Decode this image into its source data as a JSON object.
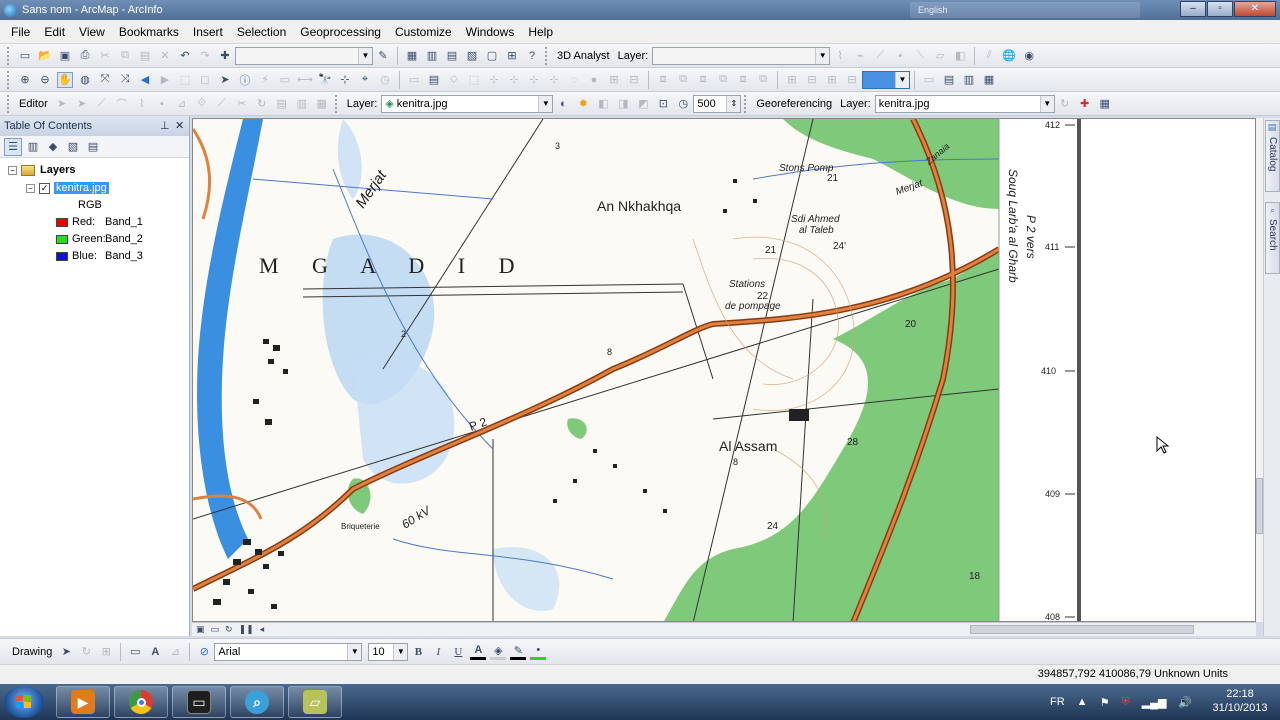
{
  "window": {
    "title": "Sans nom - ArcMap - ArcInfo",
    "language_indicator": "English"
  },
  "menu": [
    "File",
    "Edit",
    "View",
    "Bookmarks",
    "Insert",
    "Selection",
    "Geoprocessing",
    "Customize",
    "Windows",
    "Help"
  ],
  "toolbar1": {
    "analyst_label": "3D Analyst",
    "layer_label": "Layer:",
    "layer_value": ""
  },
  "toolbar3": {
    "editor_label": "Editor",
    "layer_label": "Layer:",
    "layer_value": "kenitra.jpg",
    "scale_value": "500",
    "georef_label": "Georeferencing",
    "georef_layer_label": "Layer:",
    "georef_layer_value": "kenitra.jpg"
  },
  "toc": {
    "title": "Table Of Contents",
    "layers_label": "Layers",
    "layer_name": "kenitra.jpg",
    "layer_checked": true,
    "rgb_label": "RGB",
    "bands": [
      {
        "label": "Red:",
        "band": "Band_1",
        "color": "#ee0000"
      },
      {
        "label": "Green:",
        "band": "Band_2",
        "color": "#22dd22"
      },
      {
        "label": "Blue:",
        "band": "Band_3",
        "color": "#1111dd"
      }
    ]
  },
  "map": {
    "labels": {
      "merjat": "Merjat",
      "mgadid": "M G A D I D",
      "an_nkhakhqa": "An Nkhakhqa",
      "stons_pomp": "Stons Pomp",
      "sdi_ahmed": "Sdi Ahmed",
      "al_taleb": "al Taleb",
      "stations": "Stations",
      "de_pompage": "de pompage",
      "al_assam": "Al Assam",
      "briqueterie": "Briqueterie",
      "kv": "60 kV",
      "p2": "P 2",
      "zanaia": "Zanaia",
      "merjat2": "Merjat",
      "souq": "Souq Larb'a al Gharb",
      "p2vers": "P 2 vers"
    },
    "spot_heights": [
      "3",
      "21",
      "24'",
      "21",
      "22",
      "20",
      "2",
      "8",
      "28",
      "8",
      "24",
      "18"
    ],
    "grid_labels": [
      "412",
      "411",
      "410",
      "409",
      "408"
    ]
  },
  "side_tabs": [
    "Catalog",
    "Search"
  ],
  "drawing_toolbar": {
    "drawing_label": "Drawing",
    "font_name": "Arial",
    "font_size": "10",
    "bold": "B",
    "italic": "I",
    "underline": "U",
    "font_color_glyph": "A"
  },
  "status": {
    "coordinates": "394857,792  410086,79 Unknown Units"
  },
  "taskbar": {
    "language": "FR",
    "time": "22:18",
    "date": "31/10/2013",
    "apps": [
      {
        "name": "media-player",
        "color": "#e07a1a"
      },
      {
        "name": "chrome",
        "color": "#dd3b2e"
      },
      {
        "name": "terminal",
        "color": "#1e1e1e"
      },
      {
        "name": "search",
        "color": "#3aa0d8"
      },
      {
        "name": "arcmap",
        "color": "#b8c25a"
      }
    ]
  },
  "colors": {
    "road": "#c4591e",
    "forest": "#7fc97a",
    "river": "#3a8fe0",
    "water": "#9cc7ee"
  }
}
